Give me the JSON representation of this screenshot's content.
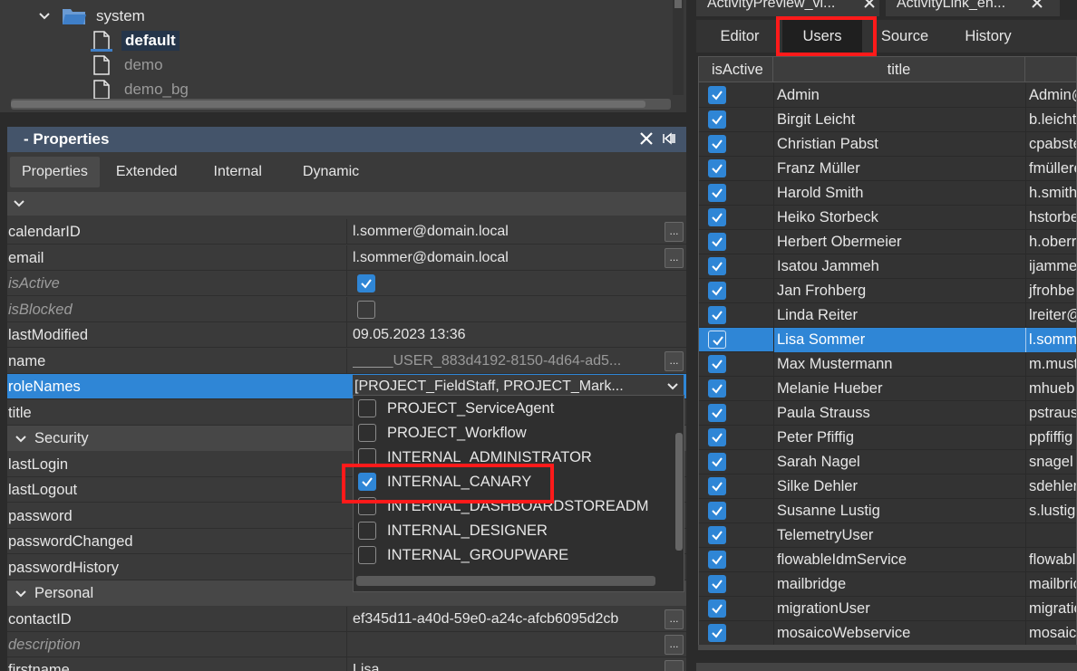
{
  "tree": {
    "folder_label": "system",
    "items": [
      "default",
      "demo",
      "demo_bg"
    ]
  },
  "properties": {
    "panel_title": "- Properties",
    "tabs": [
      "Properties",
      "Extended",
      "Internal",
      "Dynamic"
    ],
    "rows": {
      "calendarID": {
        "name": "calendarID",
        "value": "l.sommer@domain.local"
      },
      "email": {
        "name": "email",
        "value": "l.sommer@domain.local"
      },
      "isActive": {
        "name": "isActive"
      },
      "isBlocked": {
        "name": "isBlocked"
      },
      "lastModified": {
        "name": "lastModified",
        "value": "09.05.2023 13:36"
      },
      "name": {
        "name": "name",
        "value": "_____USER_883d4192-8150-4d64-ad5..."
      },
      "roleNames": {
        "name": "roleNames",
        "value": "[PROJECT_FieldStaff, PROJECT_Mark..."
      },
      "title": {
        "name": "title"
      },
      "lastLogin": {
        "name": "lastLogin"
      },
      "lastLogout": {
        "name": "lastLogout"
      },
      "password": {
        "name": "password"
      },
      "passwordChanged": {
        "name": "passwordChanged"
      },
      "passwordHistory": {
        "name": "passwordHistory"
      },
      "contactID": {
        "name": "contactID",
        "value": "ef345d11-a40d-59e0-a24c-afcb6095d2cb"
      },
      "description": {
        "name": "description"
      },
      "firstname": {
        "name": "firstname",
        "value": "Lisa"
      }
    },
    "sections": {
      "security": "Security",
      "personal": "Personal"
    },
    "ellipsis": "...",
    "role_options": [
      {
        "label": "PROJECT_ServiceAgent",
        "checked": false
      },
      {
        "label": "PROJECT_Workflow",
        "checked": false
      },
      {
        "label": "INTERNAL_ADMINISTRATOR",
        "checked": false
      },
      {
        "label": "INTERNAL_CANARY",
        "checked": true
      },
      {
        "label": "INTERNAL_DASHBOARDSTOREADM",
        "checked": false
      },
      {
        "label": "INTERNAL_DESIGNER",
        "checked": false
      },
      {
        "label": "INTERNAL_GROUPWARE",
        "checked": false
      }
    ]
  },
  "right": {
    "doc_tabs": [
      "ActivityPreview_vi...",
      "ActivityLink_en..."
    ],
    "view_tabs": [
      "Editor",
      "Users",
      "Source",
      "History"
    ],
    "active_view_tab": "Users",
    "columns": [
      "isActive",
      "title"
    ],
    "users": [
      {
        "title": "Admin",
        "login": "Admin@"
      },
      {
        "title": "Birgit Leicht",
        "login": "b.leicht"
      },
      {
        "title": "Christian Pabst",
        "login": "cpabste"
      },
      {
        "title": "Franz Müller",
        "login": "fmüllere"
      },
      {
        "title": "Harold Smith",
        "login": "h.smith"
      },
      {
        "title": "Heiko Storbeck",
        "login": "hstorbe"
      },
      {
        "title": "Herbert Obermeier",
        "login": "h.oberr"
      },
      {
        "title": "Isatou Jammeh",
        "login": "ijamme"
      },
      {
        "title": "Jan Frohberg",
        "login": "jfrohbe"
      },
      {
        "title": "Linda Reiter",
        "login": "lreiter@"
      },
      {
        "title": "Lisa Sommer",
        "login": "l.somm"
      },
      {
        "title": "Max Mustermann",
        "login": "m.must"
      },
      {
        "title": "Melanie Hueber",
        "login": "mhueb"
      },
      {
        "title": "Paula Strauss",
        "login": "pstraus"
      },
      {
        "title": "Peter Pfiffig",
        "login": "ppfiffig"
      },
      {
        "title": "Sarah Nagel",
        "login": "snagel"
      },
      {
        "title": "Silke Dehler",
        "login": "sdehler"
      },
      {
        "title": "Susanne Lustig",
        "login": "s.lustig"
      },
      {
        "title": "TelemetryUser",
        "login": ""
      },
      {
        "title": "flowableIdmService",
        "login": "flowabl"
      },
      {
        "title": "mailbridge",
        "login": "mailbric"
      },
      {
        "title": "migrationUser",
        "login": "migratic"
      },
      {
        "title": "mosaicoWebservice",
        "login": "mosaico"
      }
    ],
    "selected_user": "Lisa Sommer"
  },
  "colors": {
    "accent": "#2f86d6",
    "highlight": "#ff1a1a",
    "panel_header": "#44546a"
  }
}
